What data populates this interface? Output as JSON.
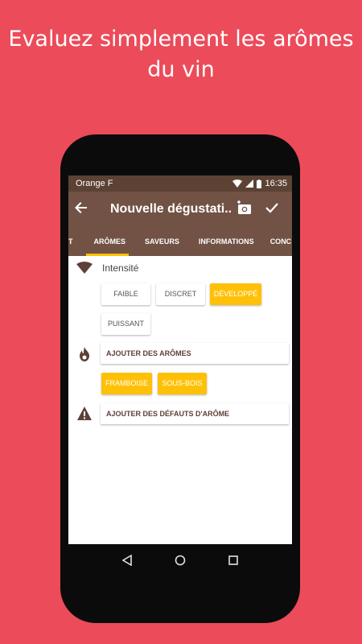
{
  "headline": {
    "line1": "Evaluez simplement les arômes",
    "line2": "du vin"
  },
  "status_bar": {
    "carrier": "Orange F",
    "time": "16:35",
    "icons": [
      "wifi-icon",
      "signal-icon",
      "battery-icon"
    ]
  },
  "app_bar": {
    "title": "Nouvelle dégustati...",
    "back_icon": "arrow-left-icon",
    "actions": [
      "add-photo-icon",
      "check-icon"
    ]
  },
  "tabs": [
    {
      "label": "T"
    },
    {
      "label": "ARÔMES",
      "active": true
    },
    {
      "label": "SAVEURS"
    },
    {
      "label": "INFORMATIONS"
    },
    {
      "label": "CONC"
    }
  ],
  "intensity": {
    "label": "Intensité",
    "icon": "wifi-signal-icon",
    "options": [
      {
        "label": "FAIBLE",
        "selected": false
      },
      {
        "label": "DISCRET",
        "selected": false
      },
      {
        "label": "DÉVELOPPÉ",
        "selected": true
      },
      {
        "label": "PUISSANT",
        "selected": false
      }
    ]
  },
  "aromas": {
    "icon": "flame-icon",
    "add_label": "AJOUTER DES ARÔMES",
    "selected": [
      "FRAMBOISE",
      "SOUS-BOIS"
    ]
  },
  "defects": {
    "icon": "warning-icon",
    "add_label": "AJOUTER DES DÉFAUTS D'ARÔME"
  },
  "nav_bar": [
    "back-triangle-icon",
    "home-circle-icon",
    "recents-square-icon"
  ],
  "colors": {
    "background": "#ec4b5a",
    "toolbar": "#715244",
    "status": "#5b4234",
    "accent": "#ffc107"
  }
}
